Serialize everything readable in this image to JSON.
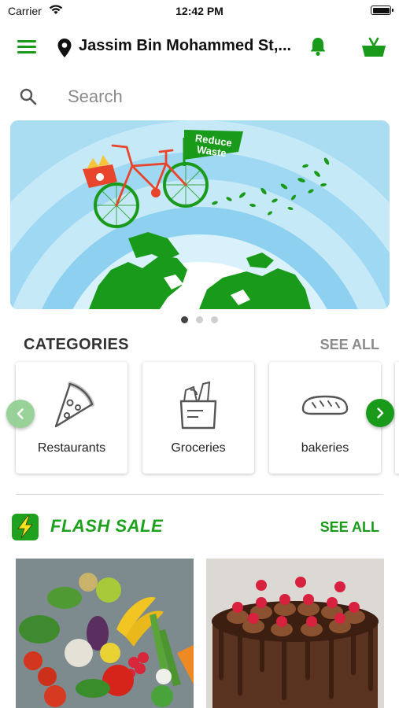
{
  "status_bar": {
    "carrier": "Carrier",
    "time": "12:42 PM"
  },
  "header": {
    "address": "Jassim Bin Mohammed St,..."
  },
  "search": {
    "placeholder": "Search"
  },
  "banner": {
    "flag_line1": "Reduce",
    "flag_line2": "Waste",
    "active_slide": 1,
    "slide_count": 3
  },
  "categories": {
    "title": "CATEGORIES",
    "see_all": "SEE ALL",
    "items": [
      {
        "label": "Restaurants",
        "icon": "pizza-slice-icon"
      },
      {
        "label": "Groceries",
        "icon": "grocery-bag-icon"
      },
      {
        "label": "bakeries",
        "icon": "bread-loaf-icon"
      }
    ]
  },
  "flash_sale": {
    "title": "FLASH SALE",
    "see_all": "SEE ALL",
    "items": [
      {
        "image": "vegetables-photo"
      },
      {
        "image": "chocolate-cake-photo"
      }
    ]
  },
  "colors": {
    "brand_green": "#1a9a1a",
    "banner_sky": "#aadcf2",
    "flash_bolt": "#f4e21b"
  }
}
